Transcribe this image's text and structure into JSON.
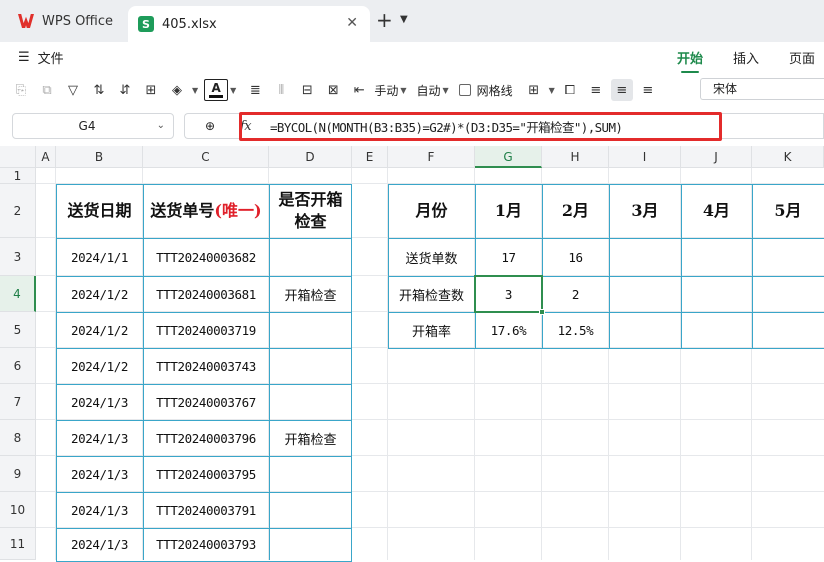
{
  "tabs": {
    "home_label": "WPS Office",
    "file_label": "405.xlsx",
    "file_icon": "S"
  },
  "ribbon": {
    "file_menu": "文件",
    "tabs": [
      "开始",
      "插入",
      "页面"
    ],
    "active_tab": "开始",
    "font_name": "宋体",
    "wrap_label": "手动",
    "auto_label": "自动",
    "gridlines_label": "网格线",
    "font_color_glyph": "A"
  },
  "formula_bar": {
    "cell_ref": "G4",
    "fx": "fx",
    "formula": "=BYCOL(N(MONTH(B3:B35)=G2#)*(D3:D35=\"开箱检查\"),SUM)",
    "highlight_color": "#e32b2b"
  },
  "grid": {
    "columns": [
      "A",
      "B",
      "C",
      "D",
      "E",
      "F",
      "G",
      "H",
      "I",
      "J",
      "K"
    ],
    "active_column": "G",
    "rows": [
      "1",
      "2",
      "3",
      "4",
      "5",
      "6",
      "7",
      "8",
      "9",
      "10",
      "11"
    ],
    "active_row": "4"
  },
  "left_table": {
    "headers": {
      "date": "送货日期",
      "order_prefix": "送货单号",
      "order_note": "(唯一)",
      "inspect": "是否开箱检查"
    },
    "rows": [
      {
        "date": "2024/1/1",
        "order": "TTT20240003682",
        "inspect": ""
      },
      {
        "date": "2024/1/2",
        "order": "TTT20240003681",
        "inspect": "开箱检查"
      },
      {
        "date": "2024/1/2",
        "order": "TTT20240003719",
        "inspect": ""
      },
      {
        "date": "2024/1/2",
        "order": "TTT20240003743",
        "inspect": ""
      },
      {
        "date": "2024/1/3",
        "order": "TTT20240003767",
        "inspect": ""
      },
      {
        "date": "2024/1/3",
        "order": "TTT20240003796",
        "inspect": "开箱检查"
      },
      {
        "date": "2024/1/3",
        "order": "TTT20240003795",
        "inspect": ""
      },
      {
        "date": "2024/1/3",
        "order": "TTT20240003791",
        "inspect": ""
      },
      {
        "date": "2024/1/3",
        "order": "TTT20240003793",
        "inspect": ""
      }
    ]
  },
  "right_table": {
    "header_label": "月份",
    "months": [
      "1月",
      "2月",
      "3月",
      "4月",
      "5月"
    ],
    "rows": [
      {
        "label": "送货单数",
        "values": [
          "17",
          "16",
          "",
          "",
          ""
        ]
      },
      {
        "label": "开箱检查数",
        "values": [
          "3",
          "2",
          "",
          "",
          ""
        ]
      },
      {
        "label": "开箱率",
        "values": [
          "17.6%",
          "12.5%",
          "",
          "",
          ""
        ]
      }
    ]
  },
  "colors": {
    "accent_green": "#2f8e4f",
    "table_border": "#3aa6c9",
    "highlight_red": "#e0202a"
  }
}
